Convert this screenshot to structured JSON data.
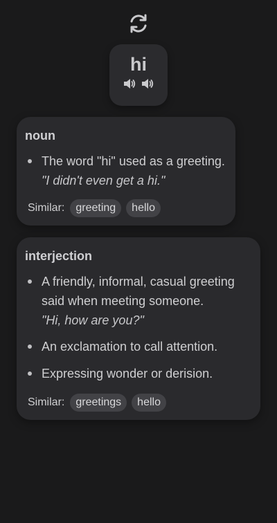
{
  "header": {
    "refresh_icon": "refresh-icon"
  },
  "word_card": {
    "word": "hi",
    "speaker_icons": [
      "speaker-icon",
      "speaker-icon"
    ]
  },
  "entries": [
    {
      "part_of_speech": "noun",
      "definitions": [
        {
          "text": "The word \"hi\" used as a greeting.",
          "example": "\"I didn't even get a hi.\""
        }
      ],
      "similar_label": "Similar:",
      "similar": [
        "greeting",
        "hello"
      ]
    },
    {
      "part_of_speech": "interjection",
      "definitions": [
        {
          "text": "A friendly, informal, casual greeting said when meeting someone.",
          "example": "\"Hi, how are you?\""
        },
        {
          "text": "An exclamation to call attention."
        },
        {
          "text": "Expressing wonder or derision."
        }
      ],
      "similar_label": "Similar:",
      "similar": [
        "greetings",
        "hello"
      ]
    }
  ]
}
